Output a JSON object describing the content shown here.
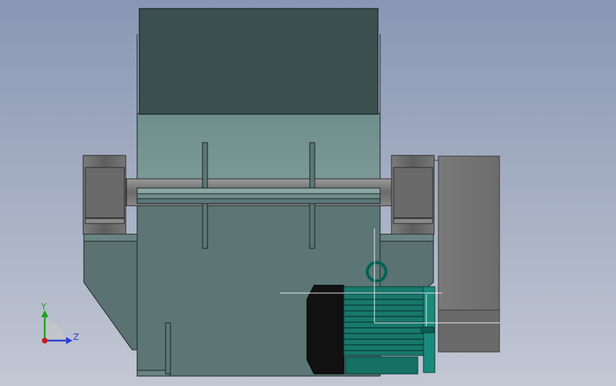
{
  "viewport": {
    "background_top": "#8997b4",
    "background_bottom": "#c2c7d3"
  },
  "model": {
    "hopper_color": "#3b4f4e",
    "body_color": "#5c7676",
    "motor_color": "#18786c",
    "motor_end_color": "#111111",
    "bearing_color": "#6a6a6a",
    "guard_color": "#737373",
    "lifting_eye_icon": "ring-icon"
  },
  "triad": {
    "y_label": "Y",
    "z_label": "Z",
    "y_color": "#1fa31f",
    "z_color": "#2a3fd1",
    "x_color": "#c21f1f"
  }
}
